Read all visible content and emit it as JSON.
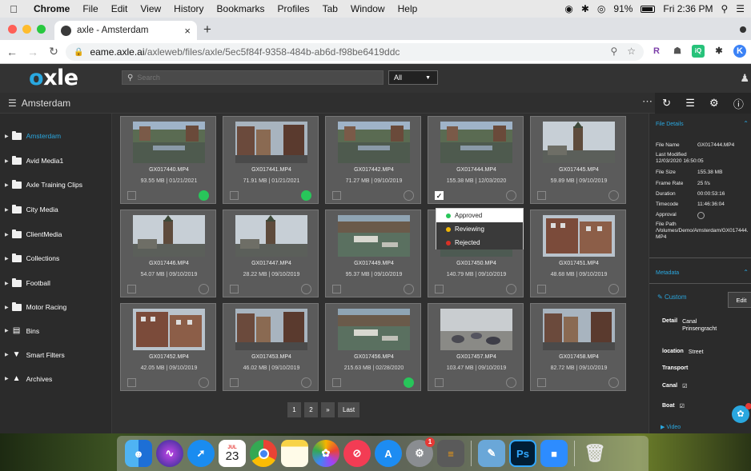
{
  "os": {
    "menubar": {
      "app": "Chrome",
      "items": [
        "File",
        "Edit",
        "View",
        "History",
        "Bookmarks",
        "Profiles",
        "Tab",
        "Window",
        "Help"
      ],
      "battery": "91%",
      "clock": "Fri 2:36 PM"
    },
    "dock": {
      "calendar_day": "23",
      "calendar_month": "JUL",
      "badge_count": "1",
      "ps_label": "Ps",
      "apps": [
        "finder",
        "siri",
        "safari",
        "calendar",
        "chrome",
        "notes",
        "photos",
        "news",
        "app-store",
        "system-preferences",
        "calculator",
        "preview",
        "photoshop",
        "zoom",
        "trash"
      ]
    }
  },
  "browser": {
    "tab_title": "axle - Amsterdam",
    "url_host": "eame.axle.ai",
    "url_path": "/axleweb/files/axle/5ec5f84f-9358-484b-ab6d-f98be6419ddc",
    "extensions": [
      "R",
      "☗",
      "iQ",
      "✱",
      "K"
    ]
  },
  "app": {
    "logo_o": "o",
    "logo_rest": "xle",
    "search_placeholder": "Search",
    "scope": "All",
    "breadcrumb": "Amsterdam",
    "sidebar": [
      {
        "label": "Amsterdam",
        "icon": "folder-icon",
        "active": true
      },
      {
        "label": "Avid Media1",
        "icon": "folder-icon"
      },
      {
        "label": "Axle Training Clips",
        "icon": "folder-icon"
      },
      {
        "label": "City Media",
        "icon": "folder-icon"
      },
      {
        "label": "ClientMedia",
        "icon": "folder-icon"
      },
      {
        "label": "Collections",
        "icon": "folder-icon"
      },
      {
        "label": "Football",
        "icon": "folder-icon"
      },
      {
        "label": "Motor Racing",
        "icon": "folder-icon"
      },
      {
        "label": "Bins",
        "icon": "bins-icon"
      },
      {
        "label": "Smart Filters",
        "icon": "filter-icon"
      },
      {
        "label": "Archives",
        "icon": "archive-icon"
      }
    ],
    "files": [
      {
        "name": "GX017440.MP4",
        "meta": "93.55 MB | 01/21/2021",
        "status": "approved",
        "checked": false,
        "scene": "canal"
      },
      {
        "name": "GX017441.MP4",
        "meta": "71.91 MB | 01/21/2021",
        "status": "approved",
        "checked": false,
        "scene": "street"
      },
      {
        "name": "GX017442.MP4",
        "meta": "71.27 MB | 09/10/2019",
        "status": "none",
        "checked": false,
        "scene": "canal"
      },
      {
        "name": "GX017444.MP4",
        "meta": "155.38 MB | 12/03/2020",
        "status": "none",
        "checked": true,
        "scene": "canal"
      },
      {
        "name": "GX017445.MP4",
        "meta": "59.89 MB | 09/10/2019",
        "status": "none",
        "checked": false,
        "scene": "tower"
      },
      {
        "name": "GX017446.MP4",
        "meta": "54.07 MB | 09/10/2019",
        "status": "none",
        "checked": false,
        "scene": "tower"
      },
      {
        "name": "GX017447.MP4",
        "meta": "28.22 MB | 09/10/2019",
        "status": "none",
        "checked": false,
        "scene": "tower"
      },
      {
        "name": "GX017449.MP4",
        "meta": "95.37 MB | 09/10/2019",
        "status": "none",
        "checked": false,
        "scene": "boats"
      },
      {
        "name": "GX017450.MP4",
        "meta": "140.79 MB | 09/10/2019",
        "status": "none",
        "checked": false,
        "scene": "hidden"
      },
      {
        "name": "GX017451.MP4",
        "meta": "48.68 MB | 09/10/2019",
        "status": "none",
        "checked": false,
        "scene": "building"
      },
      {
        "name": "GX017452.MP4",
        "meta": "42.05 MB | 09/10/2019",
        "status": "none",
        "checked": false,
        "scene": "building"
      },
      {
        "name": "GX017453.MP4",
        "meta": "46.02 MB | 09/10/2019",
        "status": "none",
        "checked": false,
        "scene": "street"
      },
      {
        "name": "GX017456.MP4",
        "meta": "215.63 MB | 02/28/2020",
        "status": "approved",
        "checked": false,
        "scene": "boats"
      },
      {
        "name": "GX017457.MP4",
        "meta": "103.47 MB | 09/10/2019",
        "status": "none",
        "checked": false,
        "scene": "pigeons"
      },
      {
        "name": "GX017458.MP4",
        "meta": "82.72 MB | 09/10/2019",
        "status": "none",
        "checked": false,
        "scene": "street"
      }
    ],
    "status_menu": [
      {
        "label": "Approved",
        "color": "#28c65a"
      },
      {
        "label": "Reviewing",
        "color": "#f2b705"
      },
      {
        "label": "Rejected",
        "color": "#d93025"
      }
    ],
    "pagination": [
      "1",
      "2",
      "»",
      "Last"
    ],
    "details": {
      "header": "File Details",
      "rows": [
        {
          "k": "File Name",
          "v": "GX017444.MP4"
        },
        {
          "k": "Last Modified",
          "v": ""
        },
        {
          "k": "12/03/2020 16:50:05",
          "v": ""
        },
        {
          "k": "File Size",
          "v": "155.38 MB"
        },
        {
          "k": "Frame Rate",
          "v": "25 f/s"
        },
        {
          "k": "Duration",
          "v": "00:00:53:16"
        },
        {
          "k": "Timecode",
          "v": "11:46:36:04"
        },
        {
          "k": "Approval",
          "v": ""
        },
        {
          "k": "File Path",
          "v": ""
        }
      ],
      "file_path": "/Volumes/Demo/Amsterdam/GX017444.MP4"
    },
    "metadata": {
      "header": "Metadata",
      "custom_label": "Custom",
      "edit_label": "Edit",
      "detail_key": "Detail",
      "detail_value": "Canal Prinsengracht",
      "location_key": "location",
      "location_value": "Street",
      "transport_key": "Transport",
      "canal_key": "Canal",
      "boat_key": "Boat",
      "video_label": "Video"
    }
  }
}
